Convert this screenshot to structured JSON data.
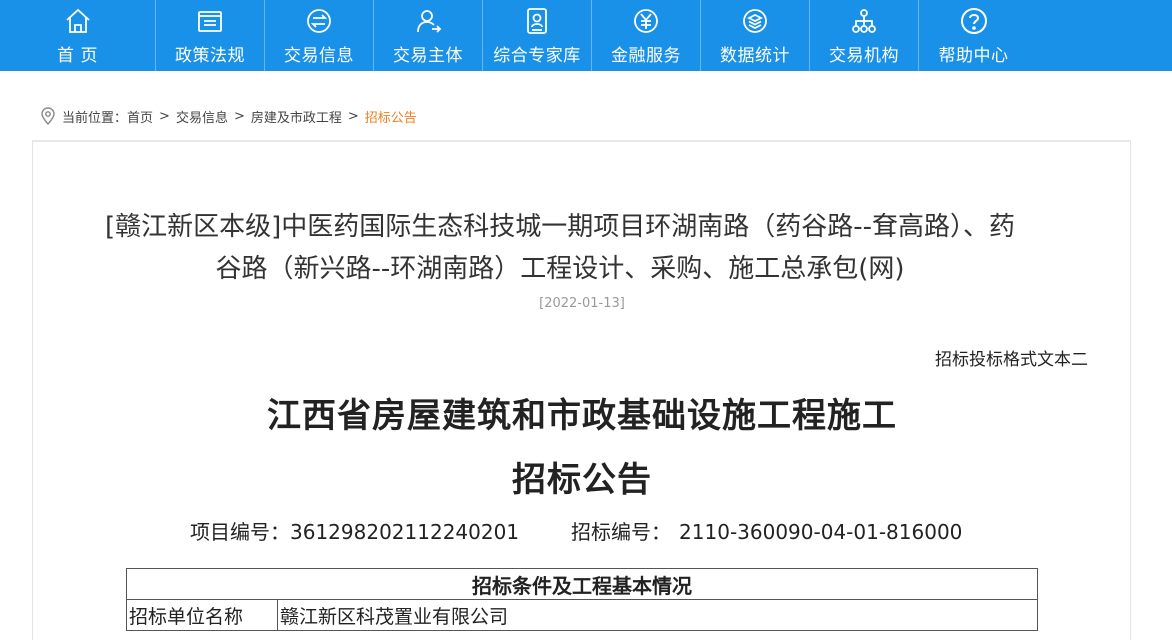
{
  "nav": {
    "items": [
      {
        "label": "首 页",
        "icon": "home-icon"
      },
      {
        "label": "政策法规",
        "icon": "folder-icon"
      },
      {
        "label": "交易信息",
        "icon": "exchange-icon"
      },
      {
        "label": "交易主体",
        "icon": "user-icon"
      },
      {
        "label": "综合专家库",
        "icon": "id-card-icon"
      },
      {
        "label": "金融服务",
        "icon": "yuan-icon"
      },
      {
        "label": "数据统计",
        "icon": "layers-icon"
      },
      {
        "label": "交易机构",
        "icon": "org-chart-icon"
      },
      {
        "label": "帮助中心",
        "icon": "help-icon"
      }
    ],
    "bg_color": "#1a91e8"
  },
  "breadcrumb": {
    "prefix": "当前位置：",
    "items": [
      "首页",
      "交易信息",
      "房建及市政工程"
    ],
    "current": "招标公告",
    "sep": ">",
    "current_color": "#f07e1b"
  },
  "article": {
    "title_line1": "[赣江新区本级]中医药国际生态科技城一期项目环湖南路（药谷路--耷高路）、药",
    "title_line2": "谷路（新兴路--环湖南路）工程设计、采购、施工总承包(网)",
    "date": "[2022-01-13]"
  },
  "document": {
    "format_note": "招标投标格式文本二",
    "title_line1": "江西省房屋建筑和市政基础设施工程施工",
    "title_line2": "招标公告",
    "project_no_label": "项目编号：",
    "project_no": "361298202112240201",
    "bid_no_label": "招标编号：",
    "bid_no": "2110-360090-04-01-816000",
    "table_header": "招标条件及工程基本情况",
    "rows": [
      {
        "key": "招标单位名称",
        "value": "赣江新区科茂置业有限公司"
      }
    ]
  }
}
